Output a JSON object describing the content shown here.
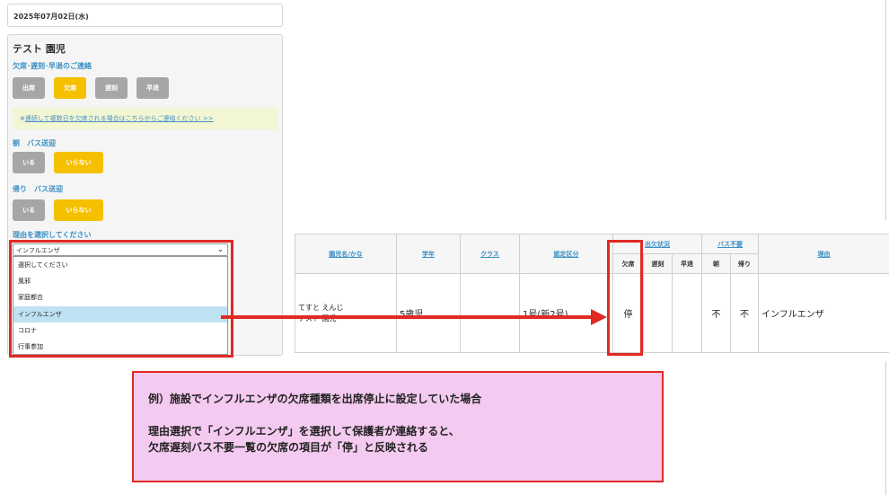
{
  "date_label": "2025年07月02日(水)",
  "child_name": "テスト 園児",
  "attendance": {
    "section_label": "欠席･遅刻･早退のご連絡",
    "buttons": [
      "出席",
      "欠席",
      "遅刻",
      "早退"
    ],
    "selected": "欠席"
  },
  "notice": {
    "prefix": "※",
    "link_text": "連続して複数日を欠席される場合はこちらからご連絡ください >>"
  },
  "bus_morning": {
    "label": "朝　バス送迎",
    "buttons": [
      "いる",
      "いらない"
    ],
    "selected": "いらない"
  },
  "bus_return": {
    "label": "帰り　バス送迎",
    "buttons": [
      "いる",
      "いらない"
    ],
    "selected": "いらない"
  },
  "reason": {
    "label": "理由を選択してください",
    "selected": "インフルエンザ",
    "options": [
      "選択してください",
      "風邪",
      "家庭都合",
      "インフルエンザ",
      "コロナ",
      "行事参加"
    ]
  },
  "table": {
    "headers": {
      "name": "園児名/かな",
      "grade": "学年",
      "class": "クラス",
      "category": "認定区分",
      "attendance_group": "出欠状況",
      "bus_group": "バス不要",
      "reason": "理由"
    },
    "subheaders": {
      "absent": "欠席",
      "late": "遅刻",
      "early": "早退",
      "morning": "朝",
      "return": "帰り"
    },
    "row": {
      "kana": "てすと えんじ",
      "name": "テスト 園児",
      "grade": "5歳児",
      "class": "",
      "category": "1号(新2号)",
      "absent": "停",
      "late": "",
      "early": "",
      "bus_morning": "不",
      "bus_return": "不",
      "reason": "インフルエンザ"
    }
  },
  "callout": {
    "line1": "例）施設でインフルエンザの欠席種類を出席停止に設定していた場合",
    "line2": "理由選択で「インフルエンザ」を選択して保護者が連絡すると、",
    "line3": "欠席遅刻バス不要一覧の欠席の項目が「停」と反映される"
  },
  "colors": {
    "accent_blue": "#3a8fc4",
    "selected_yellow": "#f5c000",
    "button_grey": "#a6a6a6",
    "annotation_red": "#e02a23",
    "callout_pink": "#f4caf0"
  }
}
